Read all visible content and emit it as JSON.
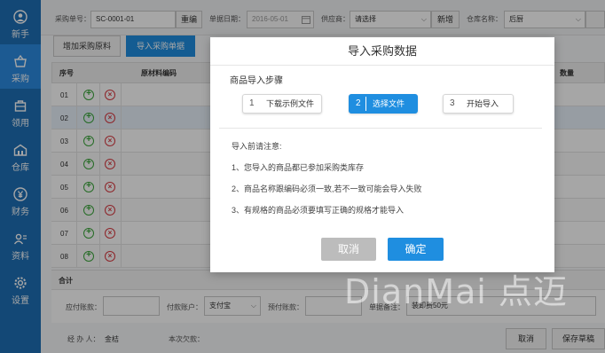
{
  "sidebar": {
    "items": [
      {
        "label": "新手",
        "icon": "user-icon"
      },
      {
        "label": "采购",
        "icon": "basket-icon"
      },
      {
        "label": "领用",
        "icon": "bag-icon"
      },
      {
        "label": "仓库",
        "icon": "warehouse-icon"
      },
      {
        "label": "财务",
        "icon": "yen-icon"
      },
      {
        "label": "资料",
        "icon": "contacts-icon"
      },
      {
        "label": "设置",
        "icon": "gear-icon"
      }
    ]
  },
  "header": {
    "order_no_label": "采购单号：",
    "order_no_value": "SC-0001-01",
    "reset_label": "重编",
    "date_label": "单据日期：",
    "date_value": "2016-05-01",
    "supplier_label": "供应商：",
    "supplier_value": "请选择",
    "add_label": "新增",
    "warehouse_label": "仓库名称：",
    "warehouse_value": "后厨"
  },
  "toolbar": {
    "add_material_label": "增加采购原料",
    "import_label": "导入采购单据"
  },
  "table": {
    "headers": {
      "seq": "序号",
      "code": "原材料编码",
      "qty": "数量"
    },
    "rows": [
      "01",
      "02",
      "03",
      "04",
      "05",
      "06",
      "07",
      "08"
    ]
  },
  "total": {
    "label": "合计"
  },
  "payment": {
    "paid_label": "应付账款：",
    "account_label": "付款账户：",
    "account_value": "支付宝",
    "prepaid_label": "预付账款：",
    "remark_label": "单据备注：",
    "remark_value": "装卸费50元"
  },
  "footer": {
    "handler_label": "经 办 人：",
    "handler_value": "金桔",
    "balance_label": "本次欠款：",
    "cancel_label": "取消",
    "save_draft_label": "保存草稿"
  },
  "modal": {
    "title": "导入采购数据",
    "steps_title": "商品导入步骤",
    "steps": [
      {
        "num": "1",
        "label": "下载示例文件"
      },
      {
        "num": "2",
        "label": "选择文件"
      },
      {
        "num": "3",
        "label": "开始导入"
      }
    ],
    "active_step": 2,
    "notes_title": "导入前请注意:",
    "notes": [
      "1、您导入的商品都已参加采购类库存",
      "2、商品名称跟编码必须一致,若不一致可能会导入失败",
      "3、有规格的商品必须要填写正确的规格才能导入"
    ],
    "cancel_label": "取消",
    "confirm_label": "确定"
  },
  "watermark": "DianMai 点迈",
  "colors": {
    "sidebar": "#1e6fb5",
    "accent": "#1f8ee0",
    "cancel_gray": "#bcbcbc",
    "add_green": "#3aa63a",
    "remove_red": "#d9363e"
  }
}
